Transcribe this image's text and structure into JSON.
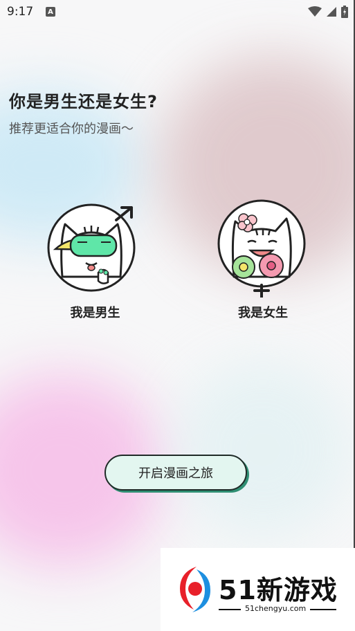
{
  "status_bar": {
    "time": "9:17",
    "notification_icon": "A"
  },
  "header": {
    "title": "你是男生还是女生?",
    "subtitle": "推荐更适合你的漫画～"
  },
  "options": [
    {
      "label": "我是男生",
      "icon": "male-symbol-icon"
    },
    {
      "label": "我是女生",
      "icon": "female-symbol-icon"
    }
  ],
  "start_button": {
    "label": "开启漫画之旅"
  },
  "watermark": {
    "title": "51新游戏",
    "url": "51chengyu.com"
  },
  "colors": {
    "button_bg": "#e3f6f0",
    "button_shadow": "#2f8f73",
    "logo_red": "#e8202a",
    "logo_blue": "#1d8fe0"
  }
}
